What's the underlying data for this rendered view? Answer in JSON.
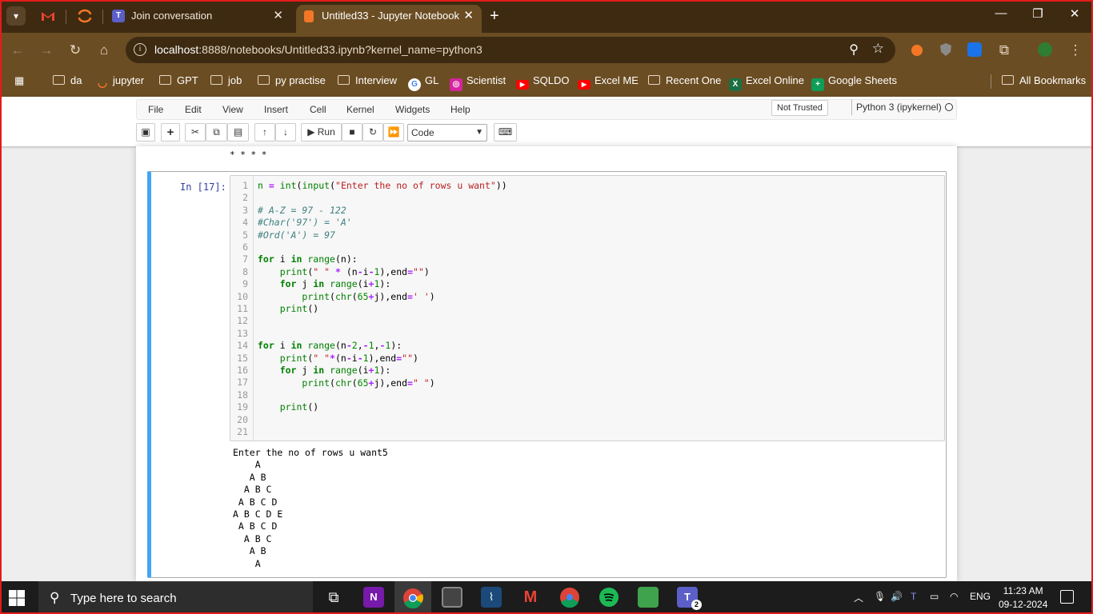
{
  "browser": {
    "tabs": [
      {
        "title": "Join conversation",
        "active": false
      },
      {
        "title": "Untitled33 - Jupyter Notebook",
        "active": true
      }
    ],
    "url_host": "localhost",
    "url_rest": ":8888/notebooks/Untitled33.ipynb?kernel_name=python3",
    "bookmarks": [
      "da",
      "jupyter",
      "GPT",
      "job",
      "py practise",
      "Interview",
      "GL",
      "Scientist",
      "SQLDO",
      "Excel ME",
      "Recent One",
      "Excel Online",
      "Google Sheets"
    ],
    "all_bookmarks": "All Bookmarks"
  },
  "jupyter": {
    "menu": [
      "File",
      "Edit",
      "View",
      "Insert",
      "Cell",
      "Kernel",
      "Widgets",
      "Help"
    ],
    "trusted": "Not Trusted",
    "kernel": "Python 3 (ipykernel)",
    "run_label": "Run",
    "cell_type": "Code",
    "prev_output": "* * * *",
    "prompt": "In [17]:",
    "line_numbers": [
      "1",
      "2",
      "3",
      "4",
      "5",
      "6",
      "7",
      "8",
      "9",
      "10",
      "11",
      "12",
      "13",
      "14",
      "15",
      "16",
      "17",
      "18",
      "19",
      "20",
      "21"
    ],
    "output_lines": [
      "Enter the no of rows u want5",
      "    A",
      "   A B",
      "  A B C",
      " A B C D",
      "A B C D E",
      " A B C D",
      "  A B C",
      "   A B",
      "    A"
    ]
  },
  "taskbar": {
    "search_placeholder": "Type here to search",
    "language": "ENG",
    "time": "11:23 AM",
    "date": "09-12-2024",
    "teams_badge": "2"
  },
  "colors": {
    "browser_frame": "#3d2a11",
    "browser_toolbar": "#6b4d23",
    "cell_selected_border": "#42a5f5",
    "screenshot_frame": "#e41b1b"
  }
}
